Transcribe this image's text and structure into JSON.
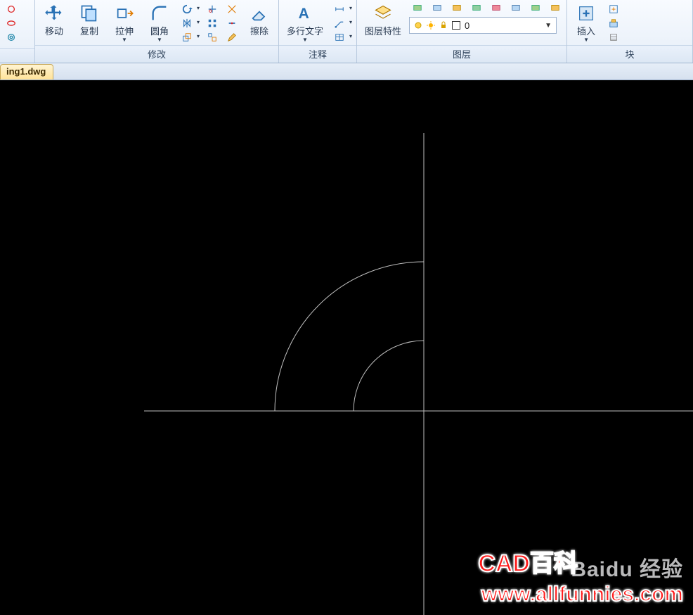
{
  "ribbon": {
    "panels": {
      "modify": {
        "title": "修改",
        "move": "移动",
        "copy": "复制",
        "stretch": "拉伸",
        "fillet": "圆角",
        "erase": "擦除"
      },
      "annotate": {
        "title": "注释",
        "mtext": "多行文字"
      },
      "layers": {
        "title": "图层",
        "properties": "图层特性",
        "current_layer": "0"
      },
      "block": {
        "title": "块",
        "insert": "插入"
      }
    }
  },
  "tab": {
    "label": "ing1.dwg"
  },
  "watermark": {
    "title": "CAD百科",
    "logo": "Baidu 经验",
    "url": "www.allfunnies.com"
  }
}
